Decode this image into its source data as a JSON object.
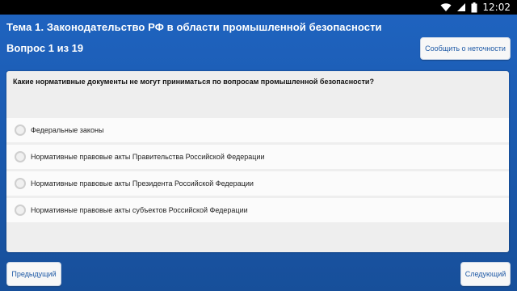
{
  "status_bar": {
    "time": "12:02",
    "icons": [
      "wifi-icon",
      "signal-icon",
      "battery-icon"
    ]
  },
  "header": {
    "title": "Тема 1. Законодательство РФ в области промышленной безопасности",
    "counter": "Вопрос 1 из 19",
    "report_button": "Сообщить о неточности"
  },
  "question": {
    "text": "Какие нормативные документы не могут приниматься по вопросам промышленной безопасности?",
    "options": [
      {
        "label": "Федеральные законы",
        "selected": false
      },
      {
        "label": "Нормативные правовые акты Правительства Российской Федерации",
        "selected": false
      },
      {
        "label": "Нормативные правовые акты Президента Российской Федерации",
        "selected": false
      },
      {
        "label": "Нормативные правовые акты субъектов Российской Федерации",
        "selected": false
      }
    ]
  },
  "footer": {
    "prev_button": "Предыдущий",
    "next_button": "Следующий"
  },
  "colors": {
    "background": "#1d5db0",
    "panel": "#eeeeee",
    "button_text": "#1f5aa6"
  }
}
